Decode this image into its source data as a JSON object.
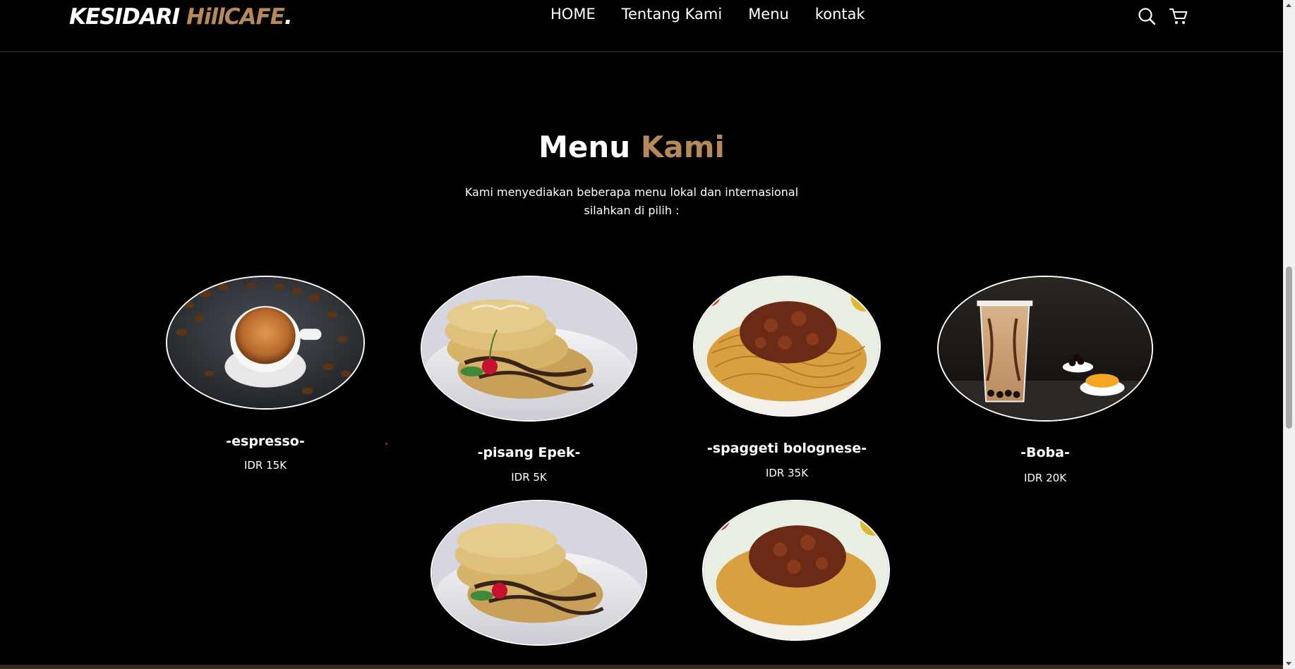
{
  "brand": {
    "name_main": "KESIDARI ",
    "name_accent": "HillCAFE",
    "name_dot": ".",
    "accent_color": "#b6895b"
  },
  "nav": {
    "links": [
      {
        "label": "HOME"
      },
      {
        "label": "Tentang Kami"
      },
      {
        "label": "Menu"
      },
      {
        "label": "kontak"
      }
    ],
    "icons": [
      "search-icon",
      "shopping-cart-icon"
    ]
  },
  "section": {
    "title_main": "Menu",
    "title_accent": "Kami",
    "desc_line1": "Kami menyediakan beberapa menu lokal dan internasional",
    "desc_line2": "silahkan di pilih :"
  },
  "menu": {
    "items": [
      {
        "name": "-espresso-",
        "price": "IDR 15K",
        "image": "espresso-photo"
      },
      {
        "name": "-pisang Epek-",
        "price": "IDR 5K",
        "image": "pisang-epek-photo"
      },
      {
        "name": "-spaggeti bolognese-",
        "price": "IDR 35K",
        "image": "spaghetti-photo"
      },
      {
        "name": "-Boba-",
        "price": "IDR 20K",
        "image": "boba-photo"
      },
      {
        "image": "pisang-epek-photo"
      },
      {
        "image": "spaghetti-photo"
      }
    ]
  }
}
